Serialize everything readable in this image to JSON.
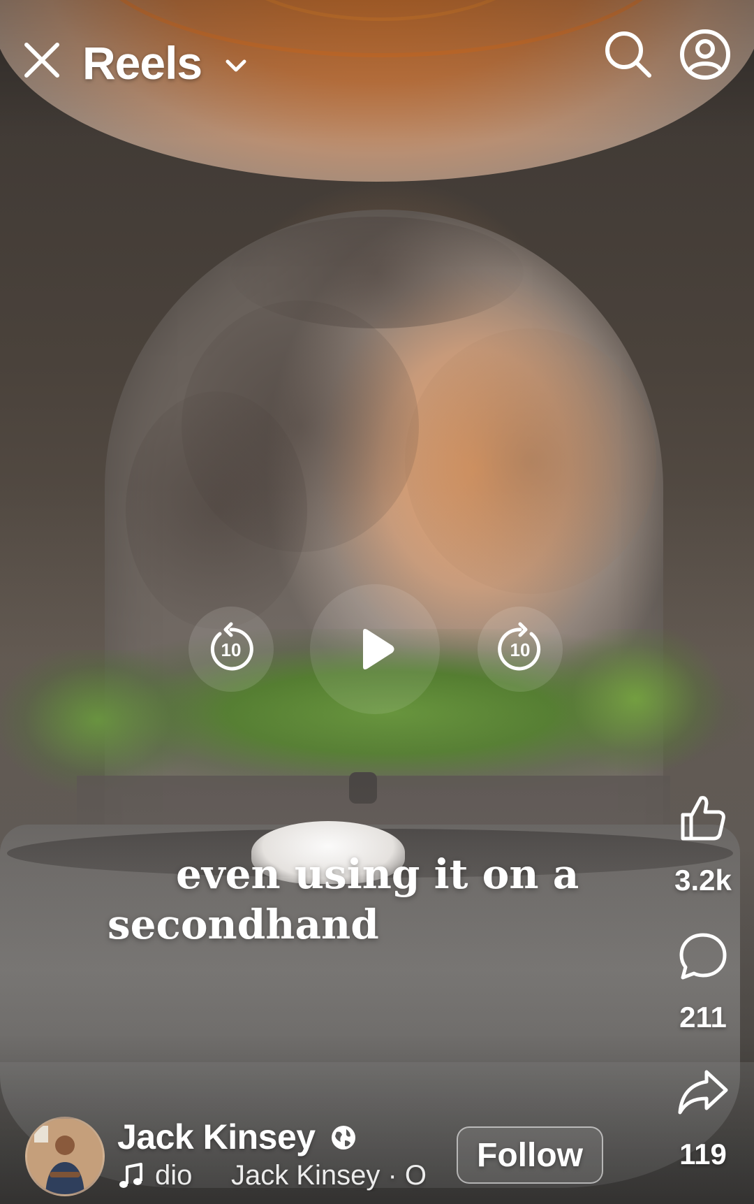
{
  "header": {
    "title": "Reels",
    "close_icon": "close-icon",
    "dropdown_icon": "chevron-down-icon",
    "search_icon": "search-icon",
    "profile_icon": "profile-icon"
  },
  "player": {
    "rewind_seconds": "10",
    "forward_seconds": "10",
    "play_icon": "play-icon"
  },
  "caption": {
    "line1": "even using it on a",
    "line2": "secondhand"
  },
  "actions": {
    "likes": "3.2k",
    "comments": "211",
    "shares": "119"
  },
  "author": {
    "name": "Jack Kinsey",
    "audio": "dio     Jack Kinsey · O",
    "follow_label": "Follow",
    "visibility_icon": "globe-icon"
  },
  "colors": {
    "text": "#ffffff",
    "warm_light": "#e9a169"
  }
}
